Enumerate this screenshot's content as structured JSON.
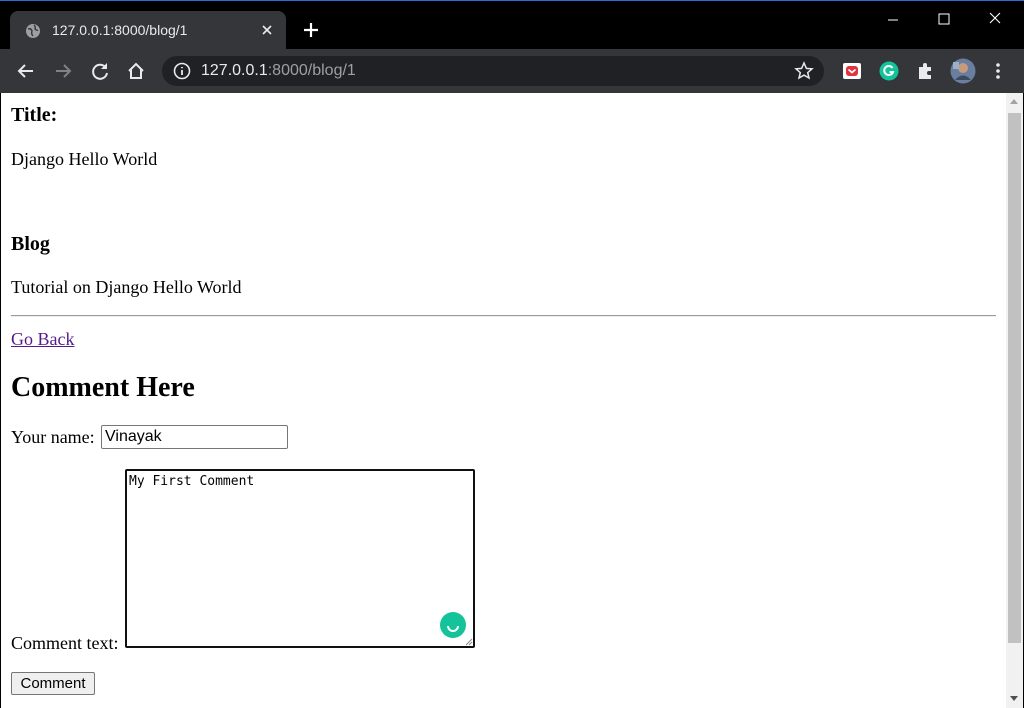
{
  "browser": {
    "tab": {
      "title": "127.0.0.1:8000/blog/1"
    },
    "address": {
      "host": "127.0.0.1",
      "rest": ":8000/blog/1"
    },
    "colors": {
      "frame": "#000000",
      "toolbar": "#35363a",
      "omnibox": "#202124",
      "accent_border": "#2b6cd4"
    },
    "extensions": [
      "pocket-icon",
      "grammarly-icon",
      "puzzle-icon"
    ]
  },
  "page": {
    "title_heading": "Title:",
    "title_value": "Django Hello World",
    "blog_heading": "Blog",
    "blog_value": "Tutorial on Django Hello World",
    "go_back": "Go Back",
    "comment_heading": "Comment Here",
    "form": {
      "name_label": "Your name:",
      "name_value": "Vinayak",
      "comment_label": "Comment text:",
      "comment_value": "My First Comment",
      "submit_label": "Comment"
    },
    "colors": {
      "link_visited": "#551a8b",
      "grammarly": "#15c39a"
    }
  }
}
